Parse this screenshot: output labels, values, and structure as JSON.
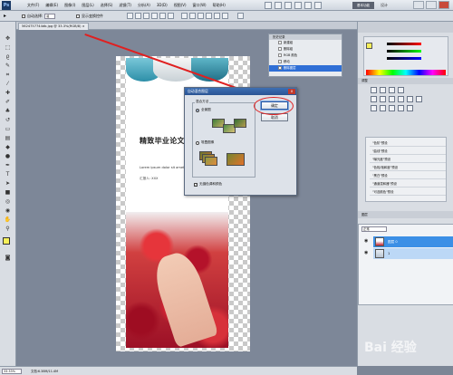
{
  "app": {
    "logo": "Ps"
  },
  "menu": [
    "文件(F)",
    "编辑(E)",
    "图像(I)",
    "图层(L)",
    "选择(S)",
    "滤镜(T)",
    "分析(A)",
    "3D(D)",
    "视图(V)",
    "窗口(W)",
    "帮助(H)"
  ],
  "menubar": {
    "essentials": "基本功能",
    "right_label": "设计",
    "close": "×"
  },
  "options": {
    "auto_select_label": "自动选择:",
    "auto_select_value": "组",
    "transform_label": "显示变换控件"
  },
  "doc_tab": "5624757744db.jpg @ 33.3%(RGB/8) ×",
  "poster": {
    "title": "精致毕业论文答辩",
    "subtitle": "Lorem ipsum dolor sit amet",
    "author": "汇报人: XXX"
  },
  "dialog": {
    "title": "自动混合图层",
    "group_label": "混合方法",
    "option1": "全景图",
    "option2": "堆叠图像",
    "checkbox": "无缝色调和颜色",
    "ok": "确定",
    "cancel": "取消",
    "close": "x"
  },
  "history": {
    "header": "历史记录",
    "rows": [
      "新建组",
      "删除组",
      "RGB 颜色",
      "移动",
      "删除图层"
    ],
    "selected_index": 4
  },
  "adjustments": {
    "header": "调整"
  },
  "presets": [
    "\"色阶\"预设",
    "\"曲线\"预设",
    "\"曝光度\"预设",
    "\"色相/饱和度\"预设",
    "\"黑白\"预设",
    "\"通道混和器\"预设",
    "\"可选颜色\"预设"
  ],
  "layers": {
    "header": "图层",
    "blend_mode": "正常",
    "rows": [
      {
        "name": "图层 0"
      },
      {
        "name": "1"
      }
    ]
  },
  "status": {
    "zoom": "33.33%",
    "doc_size": "文档:6.38M/11.4M"
  },
  "watermark": "Bai 经验",
  "colors": {
    "accent": "#2f6fd6",
    "highlight_red": "#e02020",
    "foreground_swatch": "#f6f05a"
  }
}
